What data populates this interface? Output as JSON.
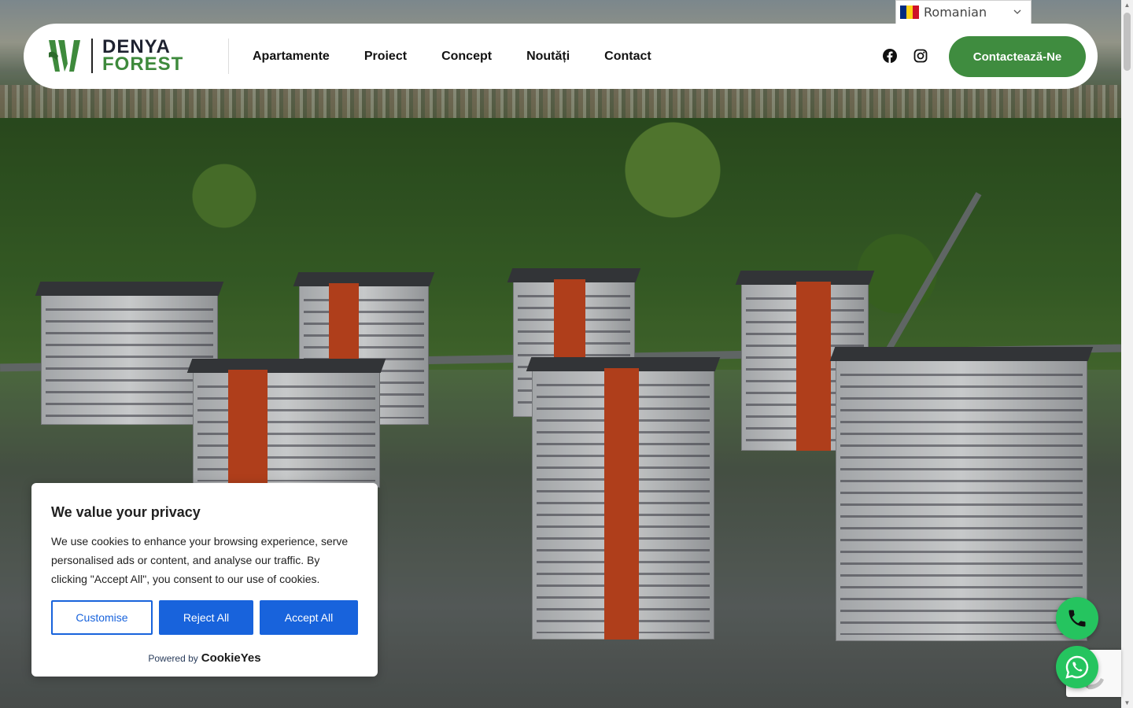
{
  "language_selector": {
    "selected": "Romanian",
    "flag_colors": [
      "#002b7f",
      "#fcd116",
      "#ce1126"
    ]
  },
  "header": {
    "logo": {
      "line1": "DENYA",
      "line2": "FOREST",
      "brand_green": "#3e8a3c",
      "brand_dark": "#1e2230"
    },
    "nav": [
      {
        "label": "Apartamente"
      },
      {
        "label": "Proiect"
      },
      {
        "label": "Concept"
      },
      {
        "label": "Noutăți"
      },
      {
        "label": "Contact"
      }
    ],
    "social": [
      "facebook-icon",
      "instagram-icon"
    ],
    "cta_label": "Contactează-Ne",
    "cta_color": "#3f8c3f"
  },
  "cookie_banner": {
    "title": "We value your privacy",
    "body": "We use cookies to enhance your browsing experience, serve personalised ads or content, and analyse our traffic. By clicking \"Accept All\", you consent to our use of cookies.",
    "customise_label": "Customise",
    "reject_label": "Reject All",
    "accept_label": "Accept All",
    "powered_by": "Powered by",
    "powered_brand": "CookieYes",
    "accent": "#1863dc"
  },
  "floating": {
    "phone_icon": "phone-icon",
    "whatsapp_icon": "whatsapp-icon",
    "color": "#25c45f"
  }
}
